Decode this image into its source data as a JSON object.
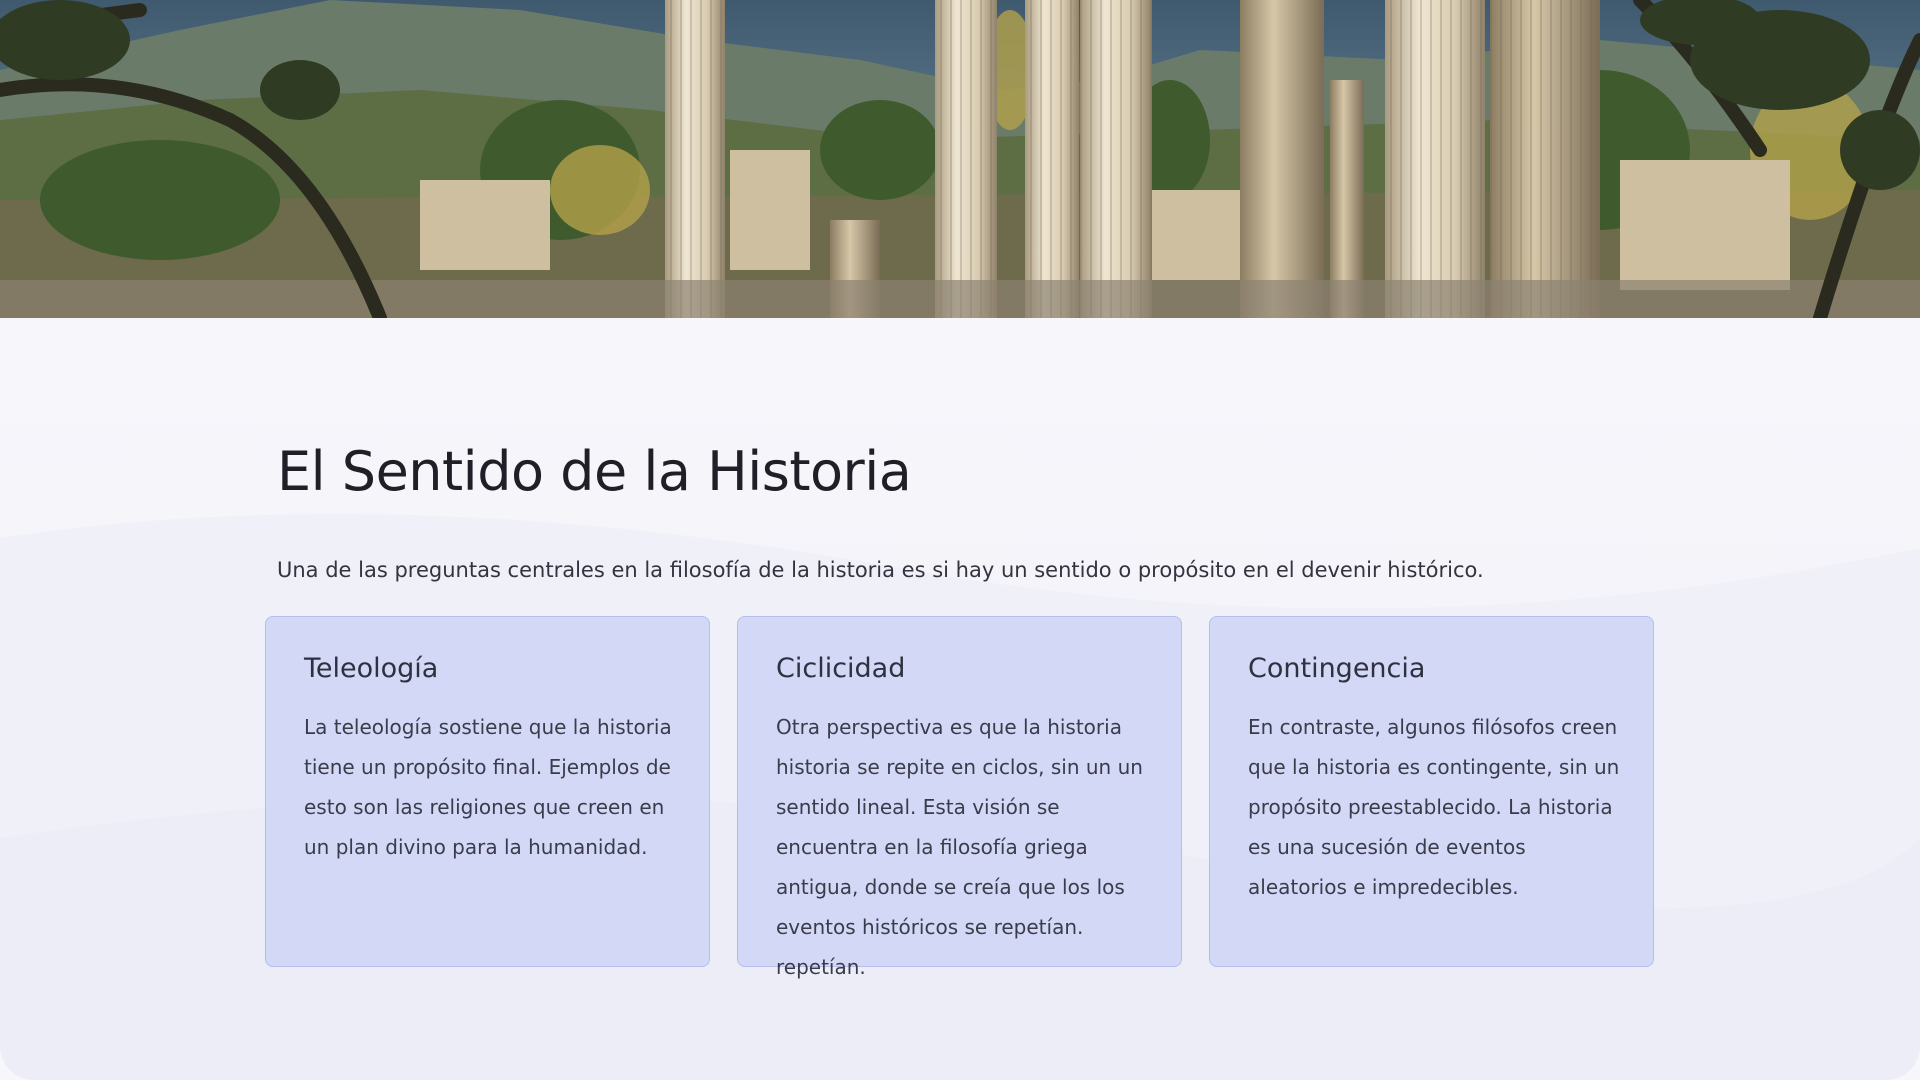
{
  "slide": {
    "title": "El Sentido de la Historia",
    "intro": "Una de las preguntas centrales en la filosofía de la historia es si hay un sentido o propósito en el devenir histórico."
  },
  "hero": {
    "image_icon": "ancient-ruins-columns-photo",
    "colors": {
      "sky": "#4d6476",
      "mountain": "#6d7a6c",
      "stone": "#d8ccb3",
      "foliage": "#5f7a36"
    }
  },
  "cards": [
    {
      "title": "Teleología",
      "body": "La teleología sostiene que la historia tiene un propósito final. Ejemplos de esto son las religiones que creen en un plan divino para la humanidad."
    },
    {
      "title": "Ciclicidad",
      "body": "Otra perspectiva es que la historia historia se repite en ciclos, sin un un sentido lineal. Esta visión se encuentra en la filosofía griega antigua, donde se creía que los los eventos históricos se repetían. repetían."
    },
    {
      "title": "Contingencia",
      "body": "En contraste, algunos filósofos creen que la historia es contingente, sin un propósito preestablecido. La historia es una sucesión de eventos aleatorios e impredecibles."
    }
  ],
  "colors": {
    "card_bg": "#d3d8f7",
    "card_border": "#b7bdea",
    "title_text": "#1f1f28",
    "page_bg": "#f7f7fb"
  }
}
